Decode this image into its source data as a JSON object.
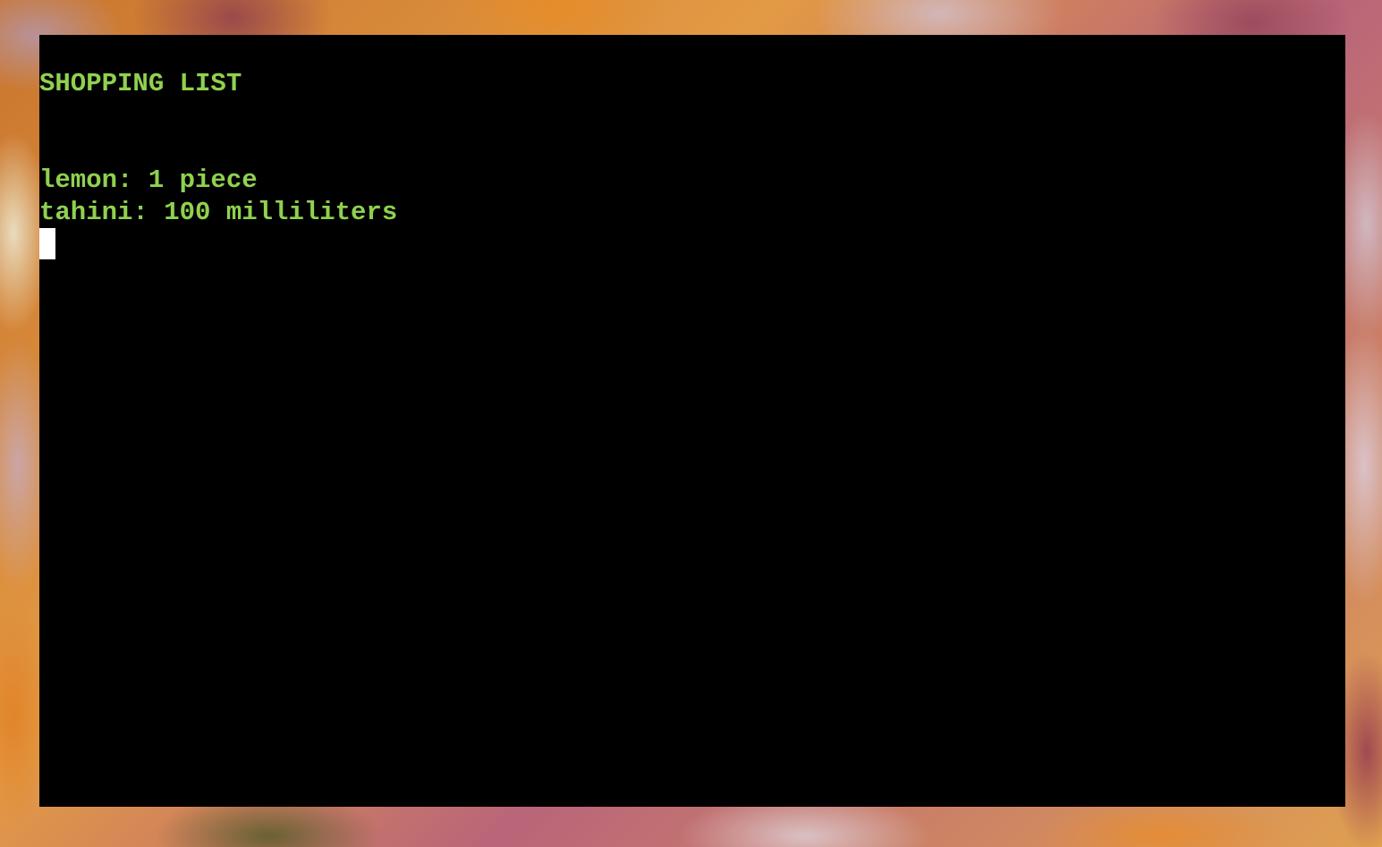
{
  "terminal": {
    "title": "SHOPPING LIST",
    "items": [
      {
        "text": "lemon: 1 piece"
      },
      {
        "text": "tahini: 100 milliliters"
      }
    ],
    "text_color": "#8fd14f",
    "background_color": "#000000",
    "cursor_color": "#ffffff"
  }
}
